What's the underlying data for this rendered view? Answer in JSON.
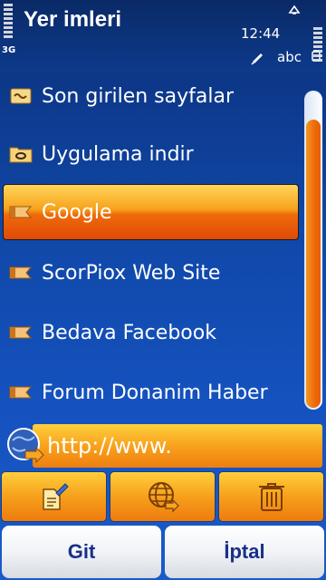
{
  "header": {
    "title": "Yer imleri",
    "clock": "12:44",
    "network": "3G",
    "input_mode": "abc"
  },
  "bookmarks": [
    {
      "label": "Son girilen sayfalar",
      "icon": "recent-pages-icon"
    },
    {
      "label": "Uygulama indir",
      "icon": "folder-icon"
    },
    {
      "label": "Google",
      "icon": "bookmark-tag-icon",
      "selected": true
    },
    {
      "label": "ScorPiox Web Site",
      "icon": "bookmark-tag-icon"
    },
    {
      "label": "Bedava Facebook",
      "icon": "bookmark-tag-icon"
    },
    {
      "label": "Forum Donanim Haber",
      "icon": "bookmark-tag-icon"
    }
  ],
  "url_bar": {
    "value": "http://www.",
    "icon": "globe-go-icon"
  },
  "toolbar": {
    "items": [
      {
        "icon": "edit-bookmark-icon"
      },
      {
        "icon": "globe-navigate-icon"
      },
      {
        "icon": "trash-icon"
      }
    ]
  },
  "softkeys": {
    "left": "Git",
    "right": "İptal"
  },
  "colors": {
    "background": "#1048a8",
    "accent": "#ee6a0b",
    "highlight": "#ffd55a",
    "softkey_text": "#1a2f88"
  }
}
